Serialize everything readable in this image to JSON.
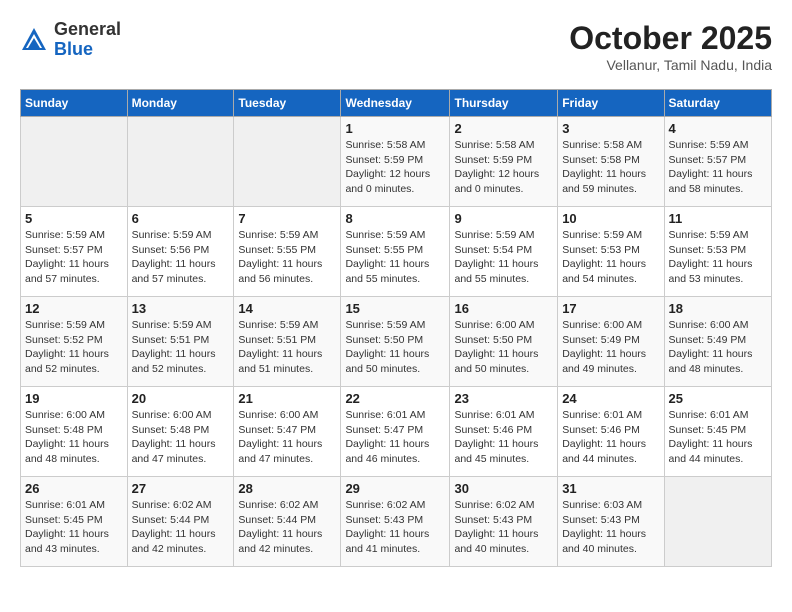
{
  "header": {
    "logo": {
      "general": "General",
      "blue": "Blue"
    },
    "title": "October 2025",
    "subtitle": "Vellanur, Tamil Nadu, India"
  },
  "weekdays": [
    "Sunday",
    "Monday",
    "Tuesday",
    "Wednesday",
    "Thursday",
    "Friday",
    "Saturday"
  ],
  "weeks": [
    [
      {
        "day": null
      },
      {
        "day": null
      },
      {
        "day": null
      },
      {
        "day": 1,
        "sunrise": "5:58 AM",
        "sunset": "5:59 PM",
        "daylight": "12 hours and 0 minutes."
      },
      {
        "day": 2,
        "sunrise": "5:58 AM",
        "sunset": "5:59 PM",
        "daylight": "12 hours and 0 minutes."
      },
      {
        "day": 3,
        "sunrise": "5:58 AM",
        "sunset": "5:58 PM",
        "daylight": "11 hours and 59 minutes."
      },
      {
        "day": 4,
        "sunrise": "5:59 AM",
        "sunset": "5:57 PM",
        "daylight": "11 hours and 58 minutes."
      }
    ],
    [
      {
        "day": 5,
        "sunrise": "5:59 AM",
        "sunset": "5:57 PM",
        "daylight": "11 hours and 57 minutes."
      },
      {
        "day": 6,
        "sunrise": "5:59 AM",
        "sunset": "5:56 PM",
        "daylight": "11 hours and 57 minutes."
      },
      {
        "day": 7,
        "sunrise": "5:59 AM",
        "sunset": "5:55 PM",
        "daylight": "11 hours and 56 minutes."
      },
      {
        "day": 8,
        "sunrise": "5:59 AM",
        "sunset": "5:55 PM",
        "daylight": "11 hours and 55 minutes."
      },
      {
        "day": 9,
        "sunrise": "5:59 AM",
        "sunset": "5:54 PM",
        "daylight": "11 hours and 55 minutes."
      },
      {
        "day": 10,
        "sunrise": "5:59 AM",
        "sunset": "5:53 PM",
        "daylight": "11 hours and 54 minutes."
      },
      {
        "day": 11,
        "sunrise": "5:59 AM",
        "sunset": "5:53 PM",
        "daylight": "11 hours and 53 minutes."
      }
    ],
    [
      {
        "day": 12,
        "sunrise": "5:59 AM",
        "sunset": "5:52 PM",
        "daylight": "11 hours and 52 minutes."
      },
      {
        "day": 13,
        "sunrise": "5:59 AM",
        "sunset": "5:51 PM",
        "daylight": "11 hours and 52 minutes."
      },
      {
        "day": 14,
        "sunrise": "5:59 AM",
        "sunset": "5:51 PM",
        "daylight": "11 hours and 51 minutes."
      },
      {
        "day": 15,
        "sunrise": "5:59 AM",
        "sunset": "5:50 PM",
        "daylight": "11 hours and 50 minutes."
      },
      {
        "day": 16,
        "sunrise": "6:00 AM",
        "sunset": "5:50 PM",
        "daylight": "11 hours and 50 minutes."
      },
      {
        "day": 17,
        "sunrise": "6:00 AM",
        "sunset": "5:49 PM",
        "daylight": "11 hours and 49 minutes."
      },
      {
        "day": 18,
        "sunrise": "6:00 AM",
        "sunset": "5:49 PM",
        "daylight": "11 hours and 48 minutes."
      }
    ],
    [
      {
        "day": 19,
        "sunrise": "6:00 AM",
        "sunset": "5:48 PM",
        "daylight": "11 hours and 48 minutes."
      },
      {
        "day": 20,
        "sunrise": "6:00 AM",
        "sunset": "5:48 PM",
        "daylight": "11 hours and 47 minutes."
      },
      {
        "day": 21,
        "sunrise": "6:00 AM",
        "sunset": "5:47 PM",
        "daylight": "11 hours and 47 minutes."
      },
      {
        "day": 22,
        "sunrise": "6:01 AM",
        "sunset": "5:47 PM",
        "daylight": "11 hours and 46 minutes."
      },
      {
        "day": 23,
        "sunrise": "6:01 AM",
        "sunset": "5:46 PM",
        "daylight": "11 hours and 45 minutes."
      },
      {
        "day": 24,
        "sunrise": "6:01 AM",
        "sunset": "5:46 PM",
        "daylight": "11 hours and 44 minutes."
      },
      {
        "day": 25,
        "sunrise": "6:01 AM",
        "sunset": "5:45 PM",
        "daylight": "11 hours and 44 minutes."
      }
    ],
    [
      {
        "day": 26,
        "sunrise": "6:01 AM",
        "sunset": "5:45 PM",
        "daylight": "11 hours and 43 minutes."
      },
      {
        "day": 27,
        "sunrise": "6:02 AM",
        "sunset": "5:44 PM",
        "daylight": "11 hours and 42 minutes."
      },
      {
        "day": 28,
        "sunrise": "6:02 AM",
        "sunset": "5:44 PM",
        "daylight": "11 hours and 42 minutes."
      },
      {
        "day": 29,
        "sunrise": "6:02 AM",
        "sunset": "5:43 PM",
        "daylight": "11 hours and 41 minutes."
      },
      {
        "day": 30,
        "sunrise": "6:02 AM",
        "sunset": "5:43 PM",
        "daylight": "11 hours and 40 minutes."
      },
      {
        "day": 31,
        "sunrise": "6:03 AM",
        "sunset": "5:43 PM",
        "daylight": "11 hours and 40 minutes."
      },
      {
        "day": null
      }
    ]
  ],
  "labels": {
    "sunrise": "Sunrise:",
    "sunset": "Sunset:",
    "daylight": "Daylight:"
  }
}
